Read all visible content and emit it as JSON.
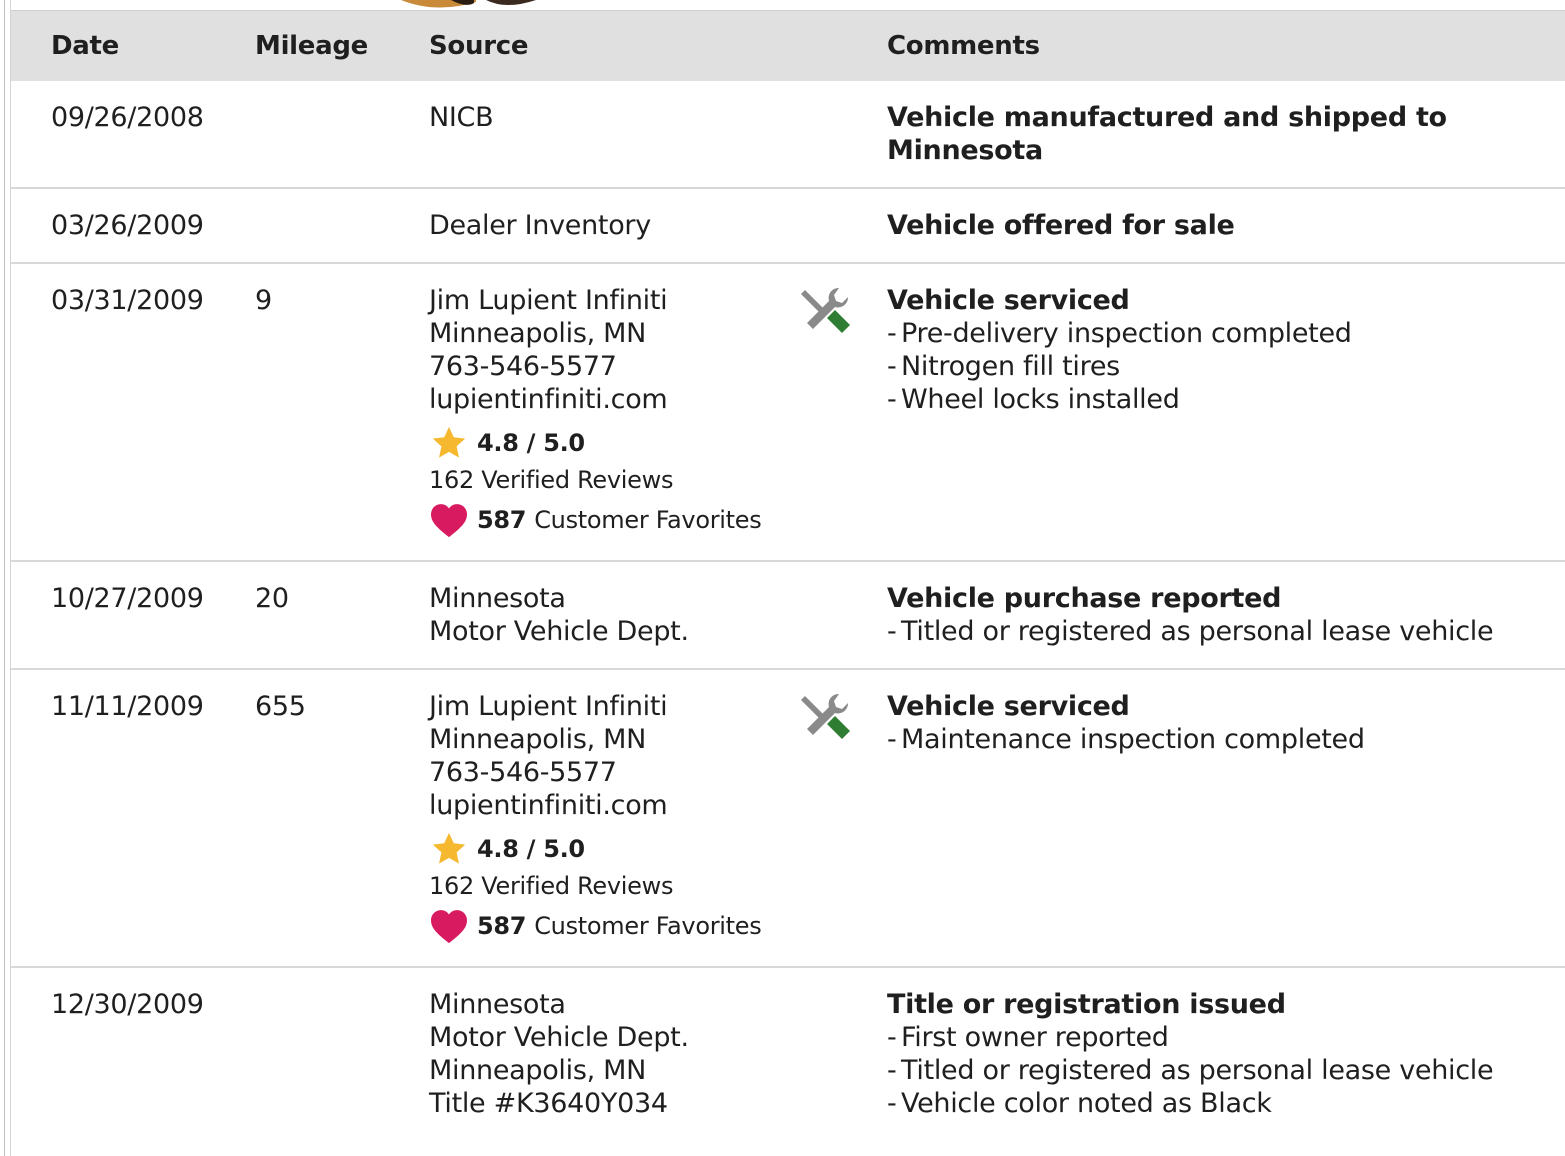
{
  "table": {
    "headers": {
      "date": "Date",
      "mileage": "Mileage",
      "source": "Source",
      "comments": "Comments"
    },
    "rows": [
      {
        "date": "09/26/2008",
        "mileage": "",
        "source_lines": [
          "NICB"
        ],
        "title": "Vehicle manufactured and shipped to Minnesota",
        "bullets": []
      },
      {
        "date": "03/26/2009",
        "mileage": "",
        "source_lines": [
          "Dealer Inventory"
        ],
        "title": "Vehicle offered for sale",
        "bullets": []
      },
      {
        "date": "03/31/2009",
        "mileage": "9",
        "source_lines": [
          "Jim Lupient Infiniti",
          "Minneapolis, MN",
          "763-546-5577",
          "lupientinfiniti.com"
        ],
        "rating": "4.8 / 5.0",
        "reviews": "162 Verified Reviews",
        "favorites_count": "587",
        "favorites_label": "Customer Favorites",
        "icon": "service-wrench-icon",
        "title": "Vehicle serviced",
        "bullets": [
          "Pre-delivery inspection completed",
          "Nitrogen fill tires",
          "Wheel locks installed"
        ]
      },
      {
        "date": "10/27/2009",
        "mileage": "20",
        "source_lines": [
          "Minnesota",
          "Motor Vehicle Dept."
        ],
        "title": "Vehicle purchase reported",
        "bullets": [
          "Titled or registered as personal lease vehicle"
        ]
      },
      {
        "date": "11/11/2009",
        "mileage": "655",
        "source_lines": [
          "Jim Lupient Infiniti",
          "Minneapolis, MN",
          "763-546-5577",
          "lupientinfiniti.com"
        ],
        "rating": "4.8 / 5.0",
        "reviews": "162 Verified Reviews",
        "favorites_count": "587",
        "favorites_label": "Customer Favorites",
        "icon": "service-wrench-icon",
        "title": "Vehicle serviced",
        "bullets": [
          "Maintenance inspection completed"
        ]
      },
      {
        "date": "12/30/2009",
        "mileage": "",
        "source_lines": [
          "Minnesota",
          "Motor Vehicle Dept.",
          "Minneapolis, MN",
          "Title #K3640Y034"
        ],
        "title": "Title or registration issued",
        "bullets": [
          "First owner reported",
          "Titled or registered as personal lease vehicle",
          "Vehicle color noted as Black"
        ]
      }
    ]
  },
  "colors": {
    "header_bg": "#e0e0e0",
    "star": "#f5b82e",
    "heart": "#d81b60",
    "wrench_green": "#2e7d32",
    "wrench_gray": "#8a8a8a"
  }
}
